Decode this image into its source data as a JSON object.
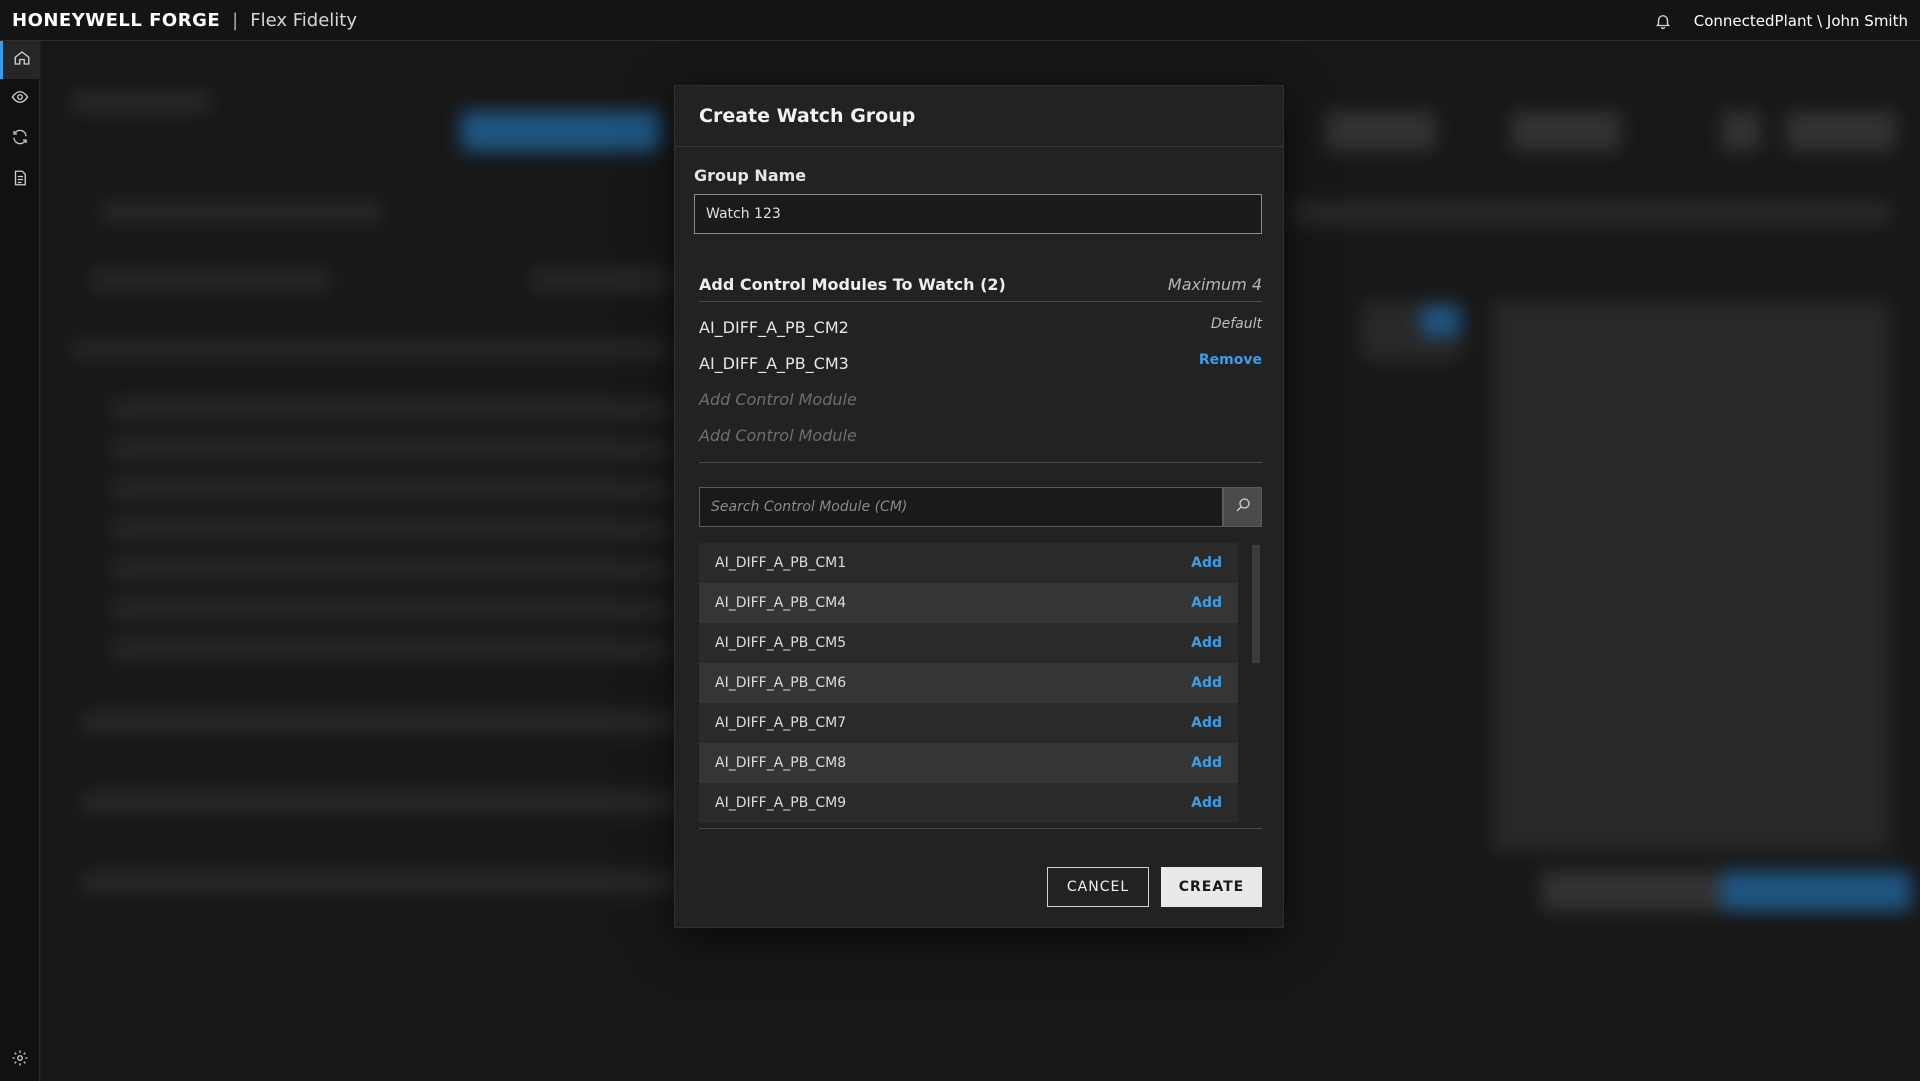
{
  "topbar": {
    "brand": "HONEYWELL FORGE",
    "separator": "|",
    "app_name": "Flex Fidelity",
    "user": "ConnectedPlant \\ John Smith",
    "icon": "bell-icon"
  },
  "rail": {
    "items": [
      {
        "icon": "home-icon",
        "active": true
      },
      {
        "icon": "eye-icon",
        "active": false
      },
      {
        "icon": "refresh-icon",
        "active": false
      },
      {
        "icon": "document-icon",
        "active": false
      }
    ],
    "bottom_icon": "gear-icon"
  },
  "modal": {
    "title": "Create Watch Group",
    "group_name_label": "Group Name",
    "group_name_value": "Watch 123",
    "section_title": "Add Control Modules To Watch (2)",
    "section_max": "Maximum 4",
    "selected": [
      {
        "name": "AI_DIFF_A_PB_CM2",
        "tag": "Default"
      },
      {
        "name": "AI_DIFF_A_PB_CM3",
        "action": "Remove"
      }
    ],
    "placeholders": [
      "Add Control Module",
      "Add Control Module"
    ],
    "search_placeholder": "Search Control Module (CM)",
    "results": [
      {
        "name": "AI_DIFF_A_PB_CM1",
        "action": "Add"
      },
      {
        "name": "AI_DIFF_A_PB_CM4",
        "action": "Add"
      },
      {
        "name": "AI_DIFF_A_PB_CM5",
        "action": "Add"
      },
      {
        "name": "AI_DIFF_A_PB_CM6",
        "action": "Add"
      },
      {
        "name": "AI_DIFF_A_PB_CM7",
        "action": "Add"
      },
      {
        "name": "AI_DIFF_A_PB_CM8",
        "action": "Add"
      },
      {
        "name": "AI_DIFF_A_PB_CM9",
        "action": "Add"
      }
    ],
    "cancel_label": "CANCEL",
    "create_label": "CREATE"
  },
  "colors": {
    "accent": "#3d9ee8",
    "background": "#1c1c1c",
    "modal": "#222222"
  }
}
